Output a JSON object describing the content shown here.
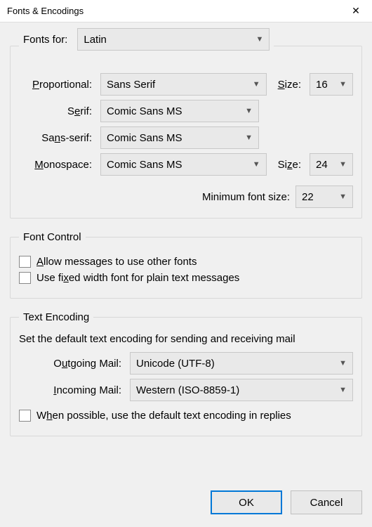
{
  "title": "Fonts & Encodings",
  "fontsFor": {
    "label": "Fonts for:",
    "value": "Latin"
  },
  "proportional": {
    "label": "Proportional:",
    "value": "Sans Serif",
    "sizeLabel": "Size:",
    "size": "16"
  },
  "serif": {
    "label": "Serif:",
    "value": "Comic Sans MS"
  },
  "sansSerif": {
    "label": "Sans-serif:",
    "value": "Comic Sans MS"
  },
  "monospace": {
    "label": "Monospace:",
    "value": "Comic Sans MS",
    "sizeLabel": "Size:",
    "size": "24"
  },
  "minFont": {
    "label": "Minimum font size:",
    "value": "22"
  },
  "fontControl": {
    "legend": "Font Control",
    "allowOther": "Allow messages to use other fonts",
    "fixedWidth": "Use fixed width font for plain text messages"
  },
  "textEncoding": {
    "legend": "Text Encoding",
    "desc": "Set the default text encoding for sending and receiving mail",
    "outgoing": {
      "label": "Outgoing Mail:",
      "value": "Unicode (UTF-8)"
    },
    "incoming": {
      "label": "Incoming Mail:",
      "value": "Western (ISO-8859-1)"
    },
    "whenPossible": "When possible, use the default text encoding in replies"
  },
  "buttons": {
    "ok": "OK",
    "cancel": "Cancel"
  }
}
